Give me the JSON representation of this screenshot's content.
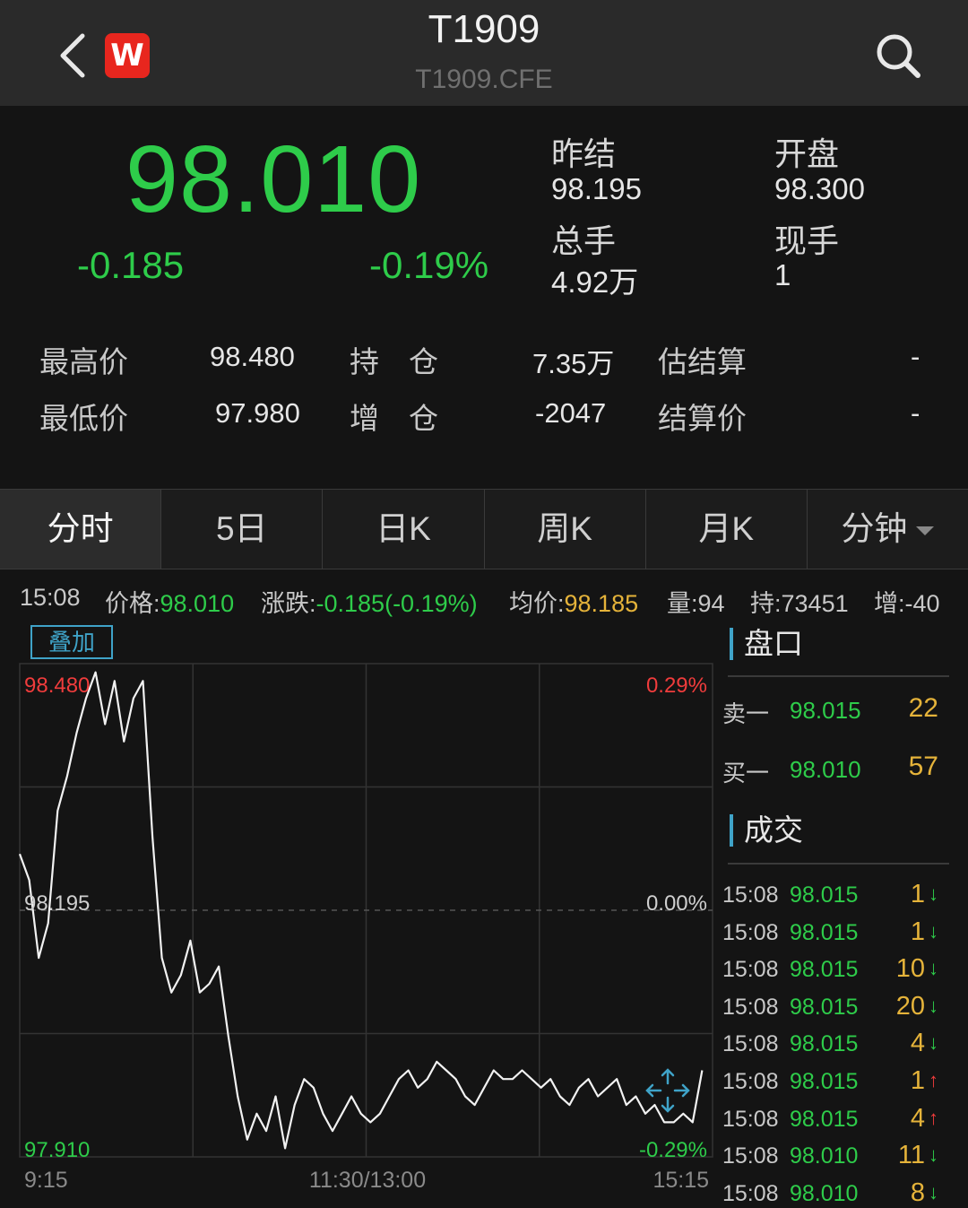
{
  "header": {
    "title": "T1909",
    "subtitle": "T1909.CFE",
    "logo_letter": "W"
  },
  "quote": {
    "price": "98.010",
    "change": "-0.185",
    "change_pct": "-0.19%",
    "prev_settle_label": "昨结",
    "prev_settle": "98.195",
    "open_label": "开盘",
    "open": "98.300",
    "volume_label": "总手",
    "volume": "4.92万",
    "last_vol_label": "现手",
    "last_vol": "1"
  },
  "stats": {
    "high_label": "最高价",
    "high": "98.480",
    "low_label": "最低价",
    "low": "97.980",
    "oi_label": "持　仓",
    "oi": "7.35万",
    "oi_chg_label": "增　仓",
    "oi_chg": "-2047",
    "est_settle_label": "估结算",
    "est_settle": "-",
    "settle_label": "结算价",
    "settle": "-"
  },
  "tabs": [
    "分时",
    "5日",
    "日K",
    "周K",
    "月K",
    "分钟"
  ],
  "infobar": {
    "time": "15:08",
    "price_label": "价格:",
    "price": "98.010",
    "chg_label": "涨跌:",
    "chg": "-0.185(-0.19%)",
    "avg_label": "均价:",
    "avg": "98.185",
    "vol_label": "量:",
    "vol": "94",
    "oi_label": "持:",
    "oi": "73451",
    "inc_label": "增:",
    "inc": "-40"
  },
  "overlay_label": "叠加",
  "chart_data": {
    "type": "line",
    "y_left_ticks": [
      "98.480",
      "98.195",
      "97.910"
    ],
    "y_right_ticks": [
      "0.29%",
      "0.00%",
      "-0.29%"
    ],
    "x_ticks": [
      "9:15",
      "11:30/13:00",
      "15:15"
    ],
    "ylim": [
      97.91,
      98.48
    ],
    "grid": true,
    "y": [
      98.26,
      98.23,
      98.14,
      98.18,
      98.31,
      98.35,
      98.4,
      98.44,
      98.47,
      98.41,
      98.46,
      98.39,
      98.44,
      98.46,
      98.28,
      98.14,
      98.1,
      98.12,
      98.16,
      98.1,
      98.11,
      98.13,
      98.05,
      97.98,
      97.93,
      97.96,
      97.94,
      97.98,
      97.92,
      97.97,
      98.0,
      97.99,
      97.96,
      97.94,
      97.96,
      97.98,
      97.96,
      97.95,
      97.96,
      97.98,
      98.0,
      98.01,
      97.99,
      98.0,
      98.02,
      98.01,
      98.0,
      97.98,
      97.97,
      97.99,
      98.01,
      98.0,
      98.0,
      98.01,
      98.0,
      97.99,
      98.0,
      97.98,
      97.97,
      97.99,
      98.0,
      97.98,
      97.99,
      98.0,
      97.97,
      97.98,
      97.96,
      97.97,
      97.95,
      97.95,
      97.96,
      97.95,
      98.01
    ]
  },
  "orderbook": {
    "title": "盘口",
    "ask_label": "卖一",
    "ask_price": "98.015",
    "ask_vol": "22",
    "bid_label": "买一",
    "bid_price": "98.010",
    "bid_vol": "57"
  },
  "trades": {
    "title": "成交",
    "rows": [
      {
        "time": "15:08",
        "price": "98.015",
        "vol": "1",
        "dir": "down"
      },
      {
        "time": "15:08",
        "price": "98.015",
        "vol": "1",
        "dir": "down"
      },
      {
        "time": "15:08",
        "price": "98.015",
        "vol": "10",
        "dir": "down"
      },
      {
        "time": "15:08",
        "price": "98.015",
        "vol": "20",
        "dir": "down"
      },
      {
        "time": "15:08",
        "price": "98.015",
        "vol": "4",
        "dir": "down"
      },
      {
        "time": "15:08",
        "price": "98.015",
        "vol": "1",
        "dir": "up"
      },
      {
        "time": "15:08",
        "price": "98.015",
        "vol": "4",
        "dir": "up"
      },
      {
        "time": "15:08",
        "price": "98.010",
        "vol": "11",
        "dir": "down"
      },
      {
        "time": "15:08",
        "price": "98.010",
        "vol": "8",
        "dir": "down"
      }
    ]
  },
  "colors": {
    "down": "#2ecc4a",
    "up": "#f03c3c",
    "accent": "#3fa3c8",
    "volume": "#e5b33a"
  }
}
